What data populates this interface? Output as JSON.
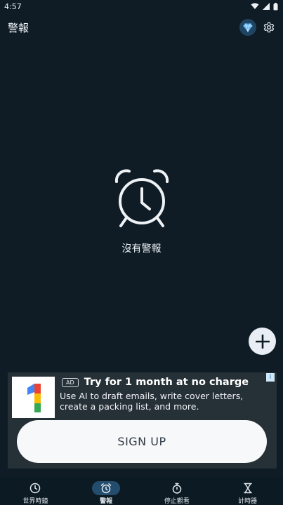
{
  "status_bar": {
    "time": "4:57"
  },
  "app_bar": {
    "title": "警報"
  },
  "empty_state": {
    "message": "沒有警報"
  },
  "ad": {
    "badge": "AD",
    "title": "Try for 1 month at no charge",
    "body": "Use AI to draft emails, write cover letters, create a packing list, and more.",
    "cta": "SIGN UP",
    "info": "i"
  },
  "bottom_nav": {
    "items": [
      {
        "label": "世界時鐘",
        "icon": "globe-clock-icon",
        "active": false
      },
      {
        "label": "警報",
        "icon": "alarm-icon",
        "active": true
      },
      {
        "label": "停止觀看",
        "icon": "stopwatch-icon",
        "active": false
      },
      {
        "label": "計時器",
        "icon": "hourglass-icon",
        "active": false
      }
    ]
  },
  "colors": {
    "background": "#0f1c26",
    "active_nav": "#234c6d",
    "ad_background": "#263037"
  }
}
